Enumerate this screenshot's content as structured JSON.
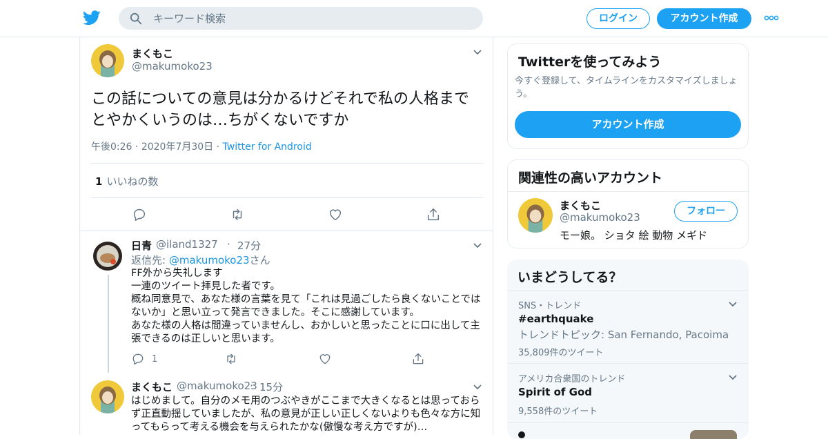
{
  "header": {
    "search_placeholder": "キーワード検索",
    "login_label": "ログイン",
    "signup_label": "アカウント作成"
  },
  "main_tweet": {
    "name": "まくもこ",
    "handle": "@makumoko23",
    "text": "この話についての意見は分かるけどそれで私の人格までとやかくいうのは…ちがくないですか",
    "time": "午後0:26",
    "date": "2020年7月30日",
    "source": "Twitter for Android",
    "likes_count": "1",
    "likes_label": "いいねの数"
  },
  "replies": [
    {
      "name": "日青",
      "handle": "@iland1327",
      "age": "27分",
      "reply_to_prefix": "返信先: ",
      "reply_to_mention": "@makumoko23",
      "reply_to_suffix": "さん",
      "text": "FF外から失礼します\n一連のツイート拝見した者です。\n概ね同意見で、あなた様の言葉を見て「これは見過ごしたら良くないことではないか」と思い立って発言できました。そこに感謝しています。\nあなた様の人格は間違っていませんし、おかしいと思ったことに口に出して主張できるのは正しいと思います。",
      "reply_count": "1"
    },
    {
      "name": "まくもこ",
      "handle": "@makumoko23",
      "age": "15分",
      "text": "はじめまして。自分のメモ用のつぶやきがここまで大きくなるとは思っておらず正直動揺していましたが、私の意見が正しい正しくないよりも色々な方に知ってもらって考える機会を与えられたかな(傲慢な考え方ですが)…"
    }
  ],
  "signup_card": {
    "title": "Twitterを使ってみよう",
    "subtitle": "今すぐ登録して、タイムラインをカスタマイズしましょう。",
    "button": "アカウント作成"
  },
  "related_card": {
    "title": "関連性の高いアカウント",
    "name": "まくもこ",
    "handle": "@makumoko23",
    "bio": "モー娘。 ショタ 絵 動物 メギド",
    "follow": "フォロー"
  },
  "trends": {
    "title": "いまどうしてる？",
    "items": [
      {
        "category": "SNS・トレンド",
        "name": "#earthquake",
        "desc": "トレンドトピック: San Fernando, Pacoima",
        "count": "35,809件のツイート"
      },
      {
        "category": "アメリカ合衆国のトレンド",
        "name": "Spirit of God",
        "count": "9,558件のツイート"
      }
    ]
  },
  "colors": {
    "accent": "#1da1f2",
    "link": "#1b95e0",
    "muted": "#657786"
  }
}
